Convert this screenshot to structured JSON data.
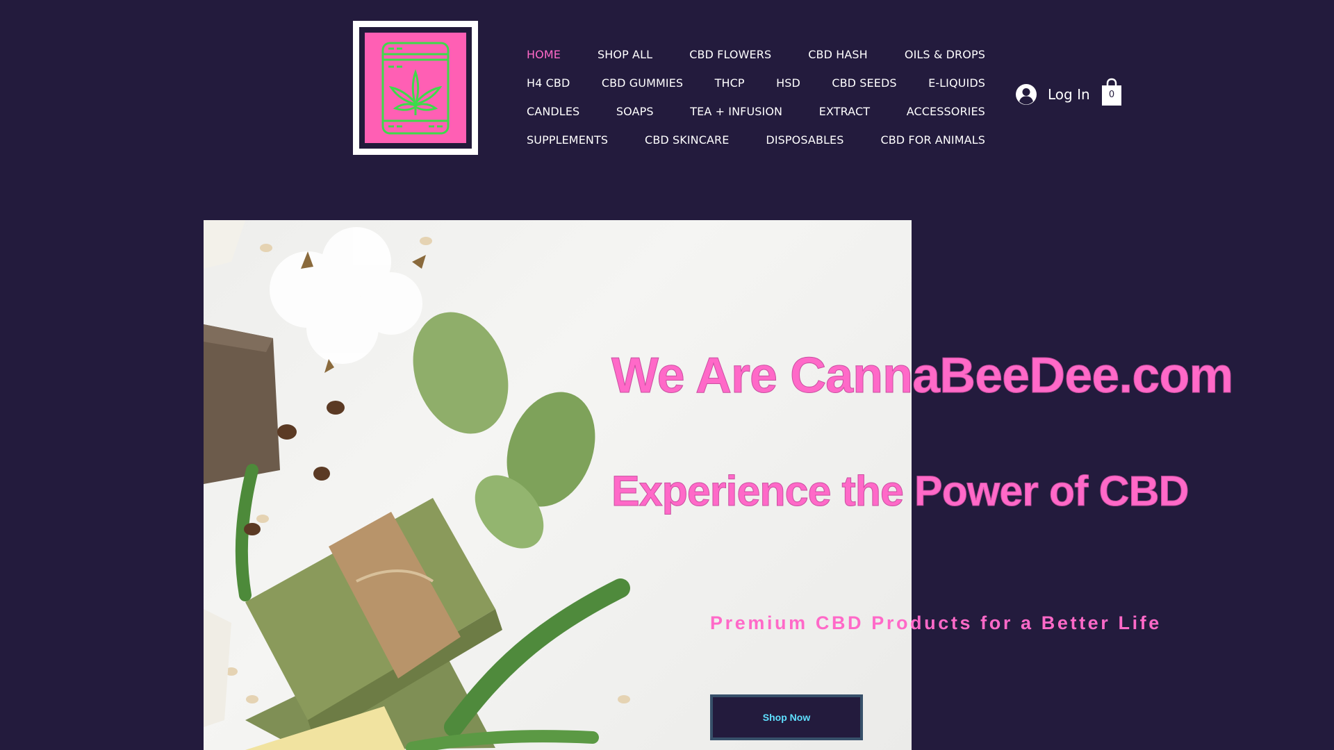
{
  "header": {
    "nav_rows": [
      [
        "HOME",
        "SHOP ALL",
        "CBD FLOWERS",
        "CBD HASH",
        "OILS & DROPS"
      ],
      [
        "H4 CBD",
        "CBD GUMMIES",
        "THCP",
        "HSD",
        "CBD SEEDS",
        "E-LIQUIDS"
      ],
      [
        "CANDLES",
        "SOAPS",
        "TEA + INFUSION",
        "EXTRACT",
        "ACCESSORIES"
      ],
      [
        "SUPPLEMENTS",
        "CBD SKINCARE",
        "DISPOSABLES",
        "CBD FOR ANIMALS"
      ]
    ],
    "active_item": "HOME",
    "login_label": "Log In",
    "cart_count": "0"
  },
  "hero": {
    "title": "We Are CannaBeeDee.com",
    "subtitle": "Experience the Power of CBD",
    "tagline": "Premium CBD Products for a Better Life",
    "cta_label": "Shop Now"
  },
  "colors": {
    "background": "#231b3d",
    "accent_pink": "#ff69c8",
    "logo_pink": "#ff5fb4",
    "logo_green": "#3ddb4a",
    "cta_text": "#5fe0ff"
  },
  "icons": {
    "logo": "cannabis-jar-icon",
    "login": "user-avatar-icon",
    "cart": "shopping-bag-icon"
  }
}
